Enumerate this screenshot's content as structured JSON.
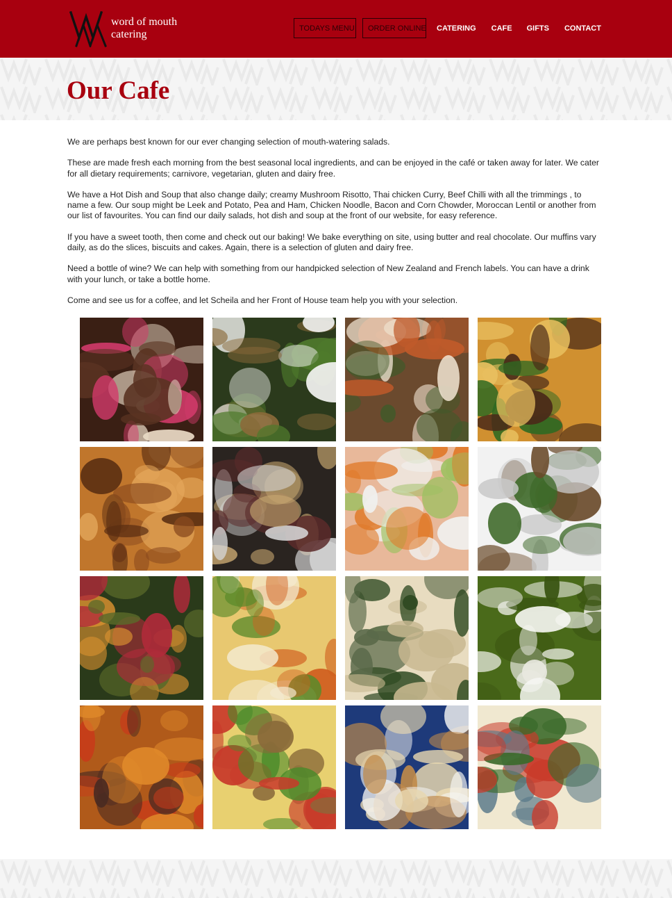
{
  "brand": {
    "line1": "word of mouth",
    "line2": "catering"
  },
  "nav": {
    "items": [
      {
        "label": "TODAYS MENU",
        "style": "boxed"
      },
      {
        "label": "ORDER ONLINE",
        "style": "boxed"
      },
      {
        "label": "CATERING",
        "style": "link"
      },
      {
        "label": "CAFE",
        "style": "link"
      },
      {
        "label": "GIFTS",
        "style": "link"
      },
      {
        "label": "CONTACT",
        "style": "link"
      }
    ]
  },
  "page": {
    "title": "Our Cafe",
    "paragraphs": [
      "We are perhaps best known for our ever changing selection of mouth-watering salads.",
      "These are made fresh each morning from the best seasonal local ingredients, and can be enjoyed in the café or taken away for later. We cater for all dietary requirements; carnivore, vegetarian, gluten and dairy free.",
      "We have a Hot Dish and Soup that also change daily; creamy Mushroom Risotto, Thai chicken Curry, Beef Chilli with all the trimmings , to name a few. Our soup might be Leek and Potato, Pea and Ham, Chicken Noodle, Bacon and Corn Chowder, Moroccan Lentil or another from our list of favourites. You can find our daily salads, hot dish and soup at the front of our website, for easy reference.",
      "If you have a sweet tooth, then come and check out our baking! We bake everything on site, using butter and real chocolate. Our muffins vary daily, as do the slices, biscuits and cakes. Again, there is a selection of gluten and dairy free.",
      "Need a bottle of wine? We can help with something from our handpicked selection of New Zealand and French labels. You can have a drink with your lunch, or take a bottle home.",
      "Come and see us for a coffee, and let Scheila and her Front of House team help you with your selection."
    ]
  },
  "colors": {
    "brand_red": "#a8000f",
    "band_gray": "#f5f5f5"
  },
  "gallery": [
    {
      "name": "chocolate-cupcakes-photo",
      "colors": [
        "#3a1f14",
        "#5a3322",
        "#e8d8c4",
        "#d23a6a"
      ]
    },
    {
      "name": "green-beans-bowl-photo",
      "colors": [
        "#2b3a1c",
        "#4f7a2c",
        "#f2f2f0",
        "#8a6a3a"
      ]
    },
    {
      "name": "roast-vegetable-salad-photo",
      "colors": [
        "#6b4a2e",
        "#c05a2a",
        "#f0e4d2",
        "#3f5a2a"
      ]
    },
    {
      "name": "frittata-parsley-photo",
      "colors": [
        "#d09030",
        "#4a2a18",
        "#2f6a22",
        "#e8c060"
      ]
    },
    {
      "name": "cinnamon-scrolls-photo",
      "colors": [
        "#c0762c",
        "#8a4a1e",
        "#e3a65a",
        "#5a2e12"
      ]
    },
    {
      "name": "wine-shelf-photo",
      "colors": [
        "#2a2420",
        "#c8a870",
        "#d6d6d6",
        "#5a2a2a"
      ]
    },
    {
      "name": "hand-tossing-salad-photo",
      "colors": [
        "#e8b89a",
        "#e07a2a",
        "#9cc060",
        "#f0f0ee"
      ]
    },
    {
      "name": "salad-bowls-display-photo",
      "colors": [
        "#f2f2f2",
        "#3f6a2a",
        "#6a4a2a",
        "#c8c8c8"
      ]
    },
    {
      "name": "chickpea-kale-salad-photo",
      "colors": [
        "#2a3a1a",
        "#d89030",
        "#b02a3a",
        "#5a6a2a"
      ]
    },
    {
      "name": "pumpkin-risotto-photo",
      "colors": [
        "#e8c870",
        "#d06020",
        "#f4ead0",
        "#5a8a2a"
      ]
    },
    {
      "name": "penne-pasta-salad-photo",
      "colors": [
        "#e8dcc0",
        "#2f4a22",
        "#c8b890",
        "#5a6a4a"
      ]
    },
    {
      "name": "green-soup-photo",
      "colors": [
        "#4a6a1a",
        "#f6f6f2",
        "#e8e8e0",
        "#3a5412"
      ]
    },
    {
      "name": "roast-vegetable-bake-photo",
      "colors": [
        "#b05a1a",
        "#e08a2a",
        "#4a2a22",
        "#c83a1a"
      ]
    },
    {
      "name": "potato-salad-photo",
      "colors": [
        "#e8d070",
        "#c83a2a",
        "#4a8a2a",
        "#8a6a3a"
      ]
    },
    {
      "name": "filled-bun-photo",
      "colors": [
        "#1e3a7a",
        "#e8d8b0",
        "#c08a4a",
        "#f4f4f2"
      ]
    },
    {
      "name": "sandwich-rolls-photo",
      "colors": [
        "#f0e8d0",
        "#c83a2a",
        "#3a6a2a",
        "#5a7a8a"
      ]
    }
  ]
}
